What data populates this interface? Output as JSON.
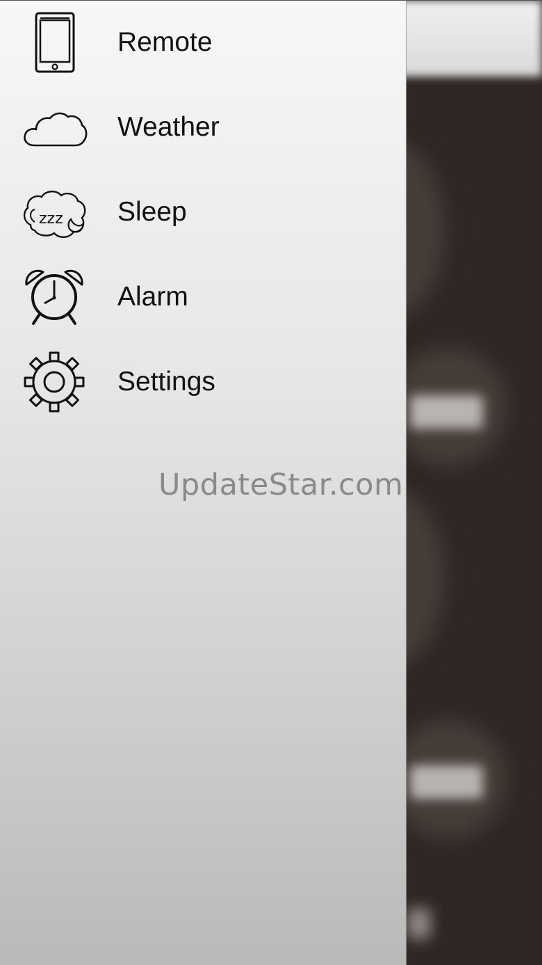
{
  "menu": {
    "items": [
      {
        "label": "Remote",
        "icon": "phone-icon"
      },
      {
        "label": "Weather",
        "icon": "cloud-icon"
      },
      {
        "label": "Sleep",
        "icon": "sleep-zzz-icon"
      },
      {
        "label": "Alarm",
        "icon": "alarm-clock-icon"
      },
      {
        "label": "Settings",
        "icon": "gear-icon"
      }
    ]
  },
  "watermark": "UpdateStar.com",
  "colors": {
    "drawer_top": "#f7f7f7",
    "drawer_bottom": "#b9b9b9",
    "background_app": "#2e2724",
    "label_text": "#111111",
    "watermark_text": "#8a8a8a"
  }
}
